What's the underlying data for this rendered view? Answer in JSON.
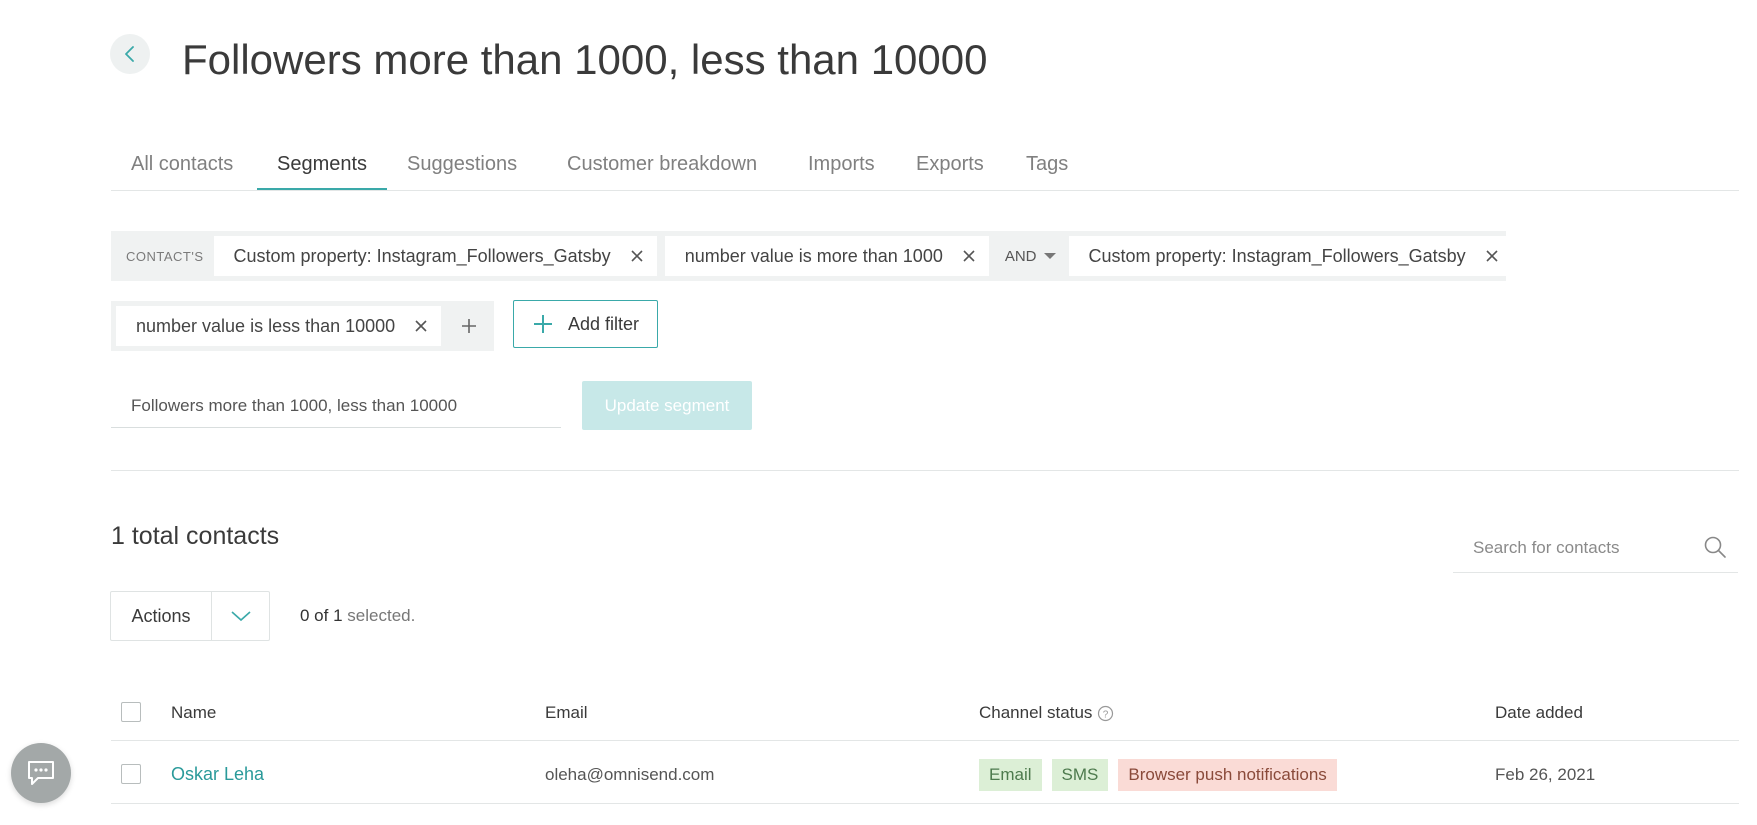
{
  "page": {
    "title": "Followers more than 1000, less than 10000"
  },
  "tabs": [
    {
      "label": "All contacts"
    },
    {
      "label": "Segments",
      "active": true
    },
    {
      "label": "Suggestions"
    },
    {
      "label": "Customer breakdown"
    },
    {
      "label": "Imports"
    },
    {
      "label": "Exports"
    },
    {
      "label": "Tags"
    }
  ],
  "filters": {
    "scope_label": "CONTACT'S",
    "chip1": "Custom property: Instagram_Followers_Gatsby",
    "chip2": "number value is more than 1000",
    "operator": "AND",
    "chip3": "Custom property: Instagram_Followers_Gatsby",
    "chip4": "number value is less than 10000",
    "add_filter_label": "Add filter"
  },
  "segment": {
    "name_value": "Followers more than 1000, less than 10000",
    "update_label": "Update segment"
  },
  "contacts": {
    "total_text": "1 total contacts",
    "search_placeholder": "Search for contacts",
    "actions_label": "Actions",
    "selected_count": "0 of 1",
    "selected_suffix": "selected."
  },
  "table": {
    "headers": {
      "name": "Name",
      "email": "Email",
      "channel_status": "Channel status",
      "date_added": "Date added"
    },
    "rows": [
      {
        "name": "Oskar Leha",
        "email": "oleha@omnisend.com",
        "channels": [
          "Email",
          "SMS",
          "Browser push notifications"
        ],
        "date_added": "Feb 26, 2021"
      }
    ]
  },
  "colors": {
    "accent": "#3aa9a9",
    "subscribed": "#dcefd6",
    "not_subscribed": "#fadbd6",
    "update_disabled": "#c7e8e8"
  },
  "icons": [
    "back-arrow-icon",
    "close-icon",
    "chevron-down-icon",
    "plus-icon",
    "search-icon",
    "help-circle-icon",
    "chat-icon"
  ]
}
